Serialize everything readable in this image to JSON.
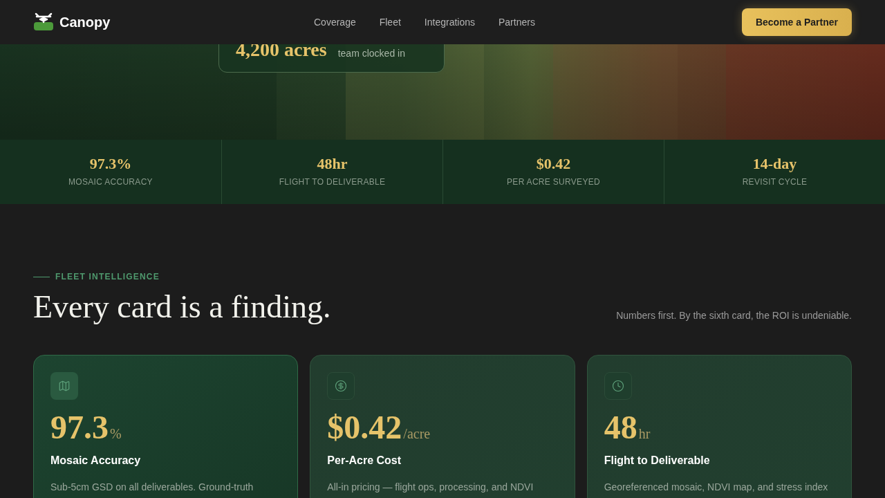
{
  "nav": {
    "brand": "Canopy",
    "links": [
      "Coverage",
      "Fleet",
      "Integrations",
      "Partners"
    ],
    "cta": "Become a Partner"
  },
  "hero": {
    "callout": {
      "value": "4,200 acres",
      "caption": "team clocked in"
    }
  },
  "stats": [
    {
      "value": "97.3%",
      "label": "MOSAIC ACCURACY"
    },
    {
      "value": "48hr",
      "label": "FLIGHT TO DELIVERABLE"
    },
    {
      "value": "$0.42",
      "label": "PER ACRE SURVEYED"
    },
    {
      "value": "14-day",
      "label": "REVISIT CYCLE"
    }
  ],
  "section": {
    "eyebrow": "FLEET INTELLIGENCE",
    "title": "Every card is a finding.",
    "note": "Numbers first. By the sixth card, the ROI is undeniable."
  },
  "cards": [
    {
      "kind": "map",
      "value": "97.3",
      "unit": "%",
      "title": "Mosaic Accuracy",
      "text": "Sub-5cm GSD on all deliverables. Ground-truth",
      "highlighted": true
    },
    {
      "kind": "dollar",
      "value": "$0.42",
      "unit": "/acre",
      "title": "Per-Acre Cost",
      "text": "All-in pricing — flight ops, processing, and NDVI",
      "highlighted": false
    },
    {
      "kind": "clock",
      "value": "48",
      "unit": "hr",
      "title": "Flight to Deliverable",
      "text": "Georeferenced mosaic, NDVI map, and stress index",
      "highlighted": false
    }
  ]
}
